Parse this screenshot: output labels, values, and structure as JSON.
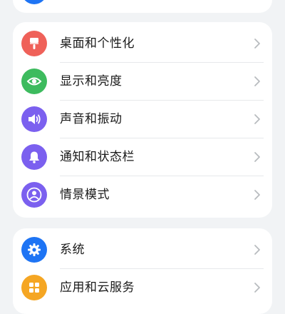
{
  "colors": {
    "background": "#f1f3f5",
    "card": "#ffffff",
    "text": "#1a1a1a",
    "chevron": "#b8bbbf",
    "desktop": "#ef6159",
    "display": "#3dbb5e",
    "sound": "#7b60ef",
    "notification": "#7b60ef",
    "scene": "#7b60ef",
    "system": "#1e74f4",
    "apps": "#f5a623"
  },
  "settings_group_1": {
    "items": [
      {
        "label": "桌面和个性化",
        "icon": "paintbrush-icon"
      },
      {
        "label": "显示和亮度",
        "icon": "eye-icon"
      },
      {
        "label": "声音和振动",
        "icon": "speaker-icon"
      },
      {
        "label": "通知和状态栏",
        "icon": "bell-icon"
      },
      {
        "label": "情景模式",
        "icon": "person-mode-icon"
      }
    ]
  },
  "settings_group_2": {
    "items": [
      {
        "label": "系统",
        "icon": "gear-icon"
      },
      {
        "label": "应用和云服务",
        "icon": "apps-icon"
      }
    ]
  }
}
